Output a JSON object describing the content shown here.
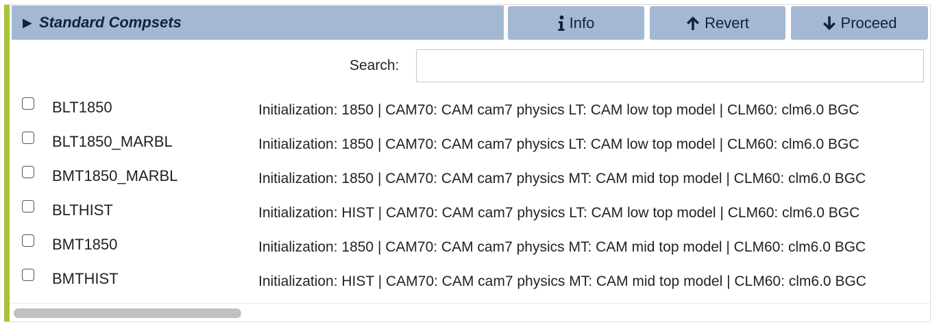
{
  "header": {
    "title": "Standard Compsets",
    "toggle_glyph": "▶",
    "buttons": {
      "info_label": "Info",
      "revert_label": "Revert",
      "proceed_label": "Proceed"
    }
  },
  "icons": {
    "toggle": "triangle-right-icon",
    "info": "info-icon",
    "revert": "arrow-up-icon",
    "proceed": "arrow-down-icon"
  },
  "search": {
    "label": "Search:",
    "value": "",
    "placeholder": ""
  },
  "compsets": [
    {
      "name": "BLT1850",
      "checked": false,
      "description": "Initialization: 1850 | CAM70: CAM cam7 physics LT: CAM low top model | CLM60: clm6.0 BGC"
    },
    {
      "name": "BLT1850_MARBL",
      "checked": false,
      "description": "Initialization: 1850 | CAM70: CAM cam7 physics LT: CAM low top model | CLM60: clm6.0 BGC"
    },
    {
      "name": "BMT1850_MARBL",
      "checked": false,
      "description": "Initialization: 1850 | CAM70: CAM cam7 physics MT: CAM mid top model | CLM60: clm6.0 BGC"
    },
    {
      "name": "BLTHIST",
      "checked": false,
      "description": "Initialization: HIST | CAM70: CAM cam7 physics LT: CAM low top model | CLM60: clm6.0 BGC"
    },
    {
      "name": "BMT1850",
      "checked": false,
      "description": "Initialization: 1850 | CAM70: CAM cam7 physics MT: CAM mid top model | CLM60: clm6.0 BGC"
    },
    {
      "name": "BMTHIST",
      "checked": false,
      "description": "Initialization: HIST | CAM70: CAM cam7 physics MT: CAM mid top model | CLM60: clm6.0 BGC"
    }
  ],
  "colors": {
    "header_bg": "#a3b8d3",
    "header_text": "#14213d",
    "accent_border": "#a6c33b",
    "scroll_thumb": "#c1c1c1"
  },
  "horizontal_scroll": {
    "position": 0
  }
}
